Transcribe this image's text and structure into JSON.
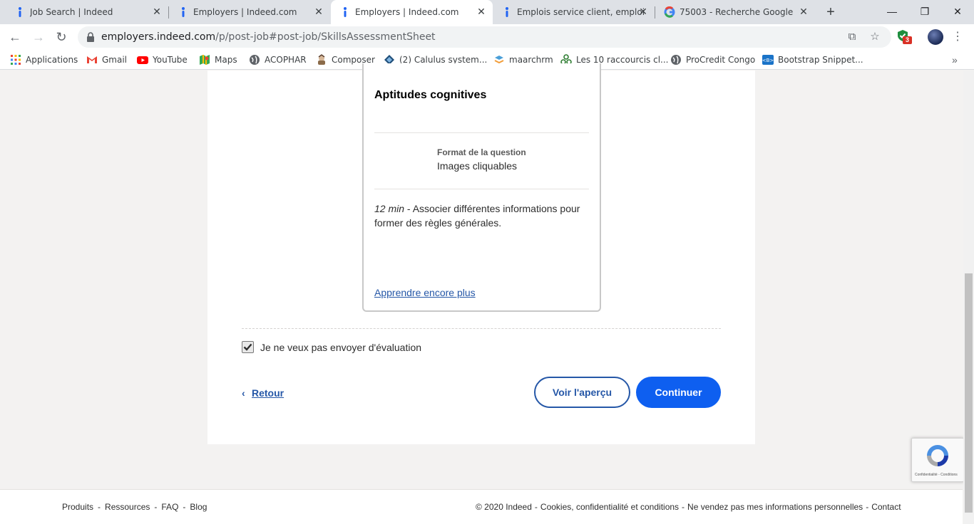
{
  "browser": {
    "tabs": [
      {
        "title": "Job Search | Indeed",
        "favicon": "indeed-icon"
      },
      {
        "title": "Employers | Indeed.com",
        "favicon": "indeed-icon"
      },
      {
        "title": "Employers | Indeed.com",
        "favicon": "indeed-icon",
        "active": true
      },
      {
        "title": "Emplois service client, emploi | ",
        "favicon": "indeed-icon"
      },
      {
        "title": "75003 - Recherche Google",
        "favicon": "google-icon"
      }
    ],
    "url_host": "employers.indeed.com",
    "url_path": "/p/post-job#post-job/SkillsAssessmentSheet",
    "extension_badge": "3",
    "bookmarks": [
      {
        "label": "Applications",
        "icon": "apps-grid-icon"
      },
      {
        "label": "Gmail",
        "icon": "gmail-icon"
      },
      {
        "label": "YouTube",
        "icon": "youtube-icon"
      },
      {
        "label": "Maps",
        "icon": "maps-icon"
      },
      {
        "label": "ACOPHAR",
        "icon": "globe-icon"
      },
      {
        "label": "Composer",
        "icon": "composer-icon"
      },
      {
        "label": "(2) Calulus system...",
        "icon": "calulus-icon"
      },
      {
        "label": "maarchrm",
        "icon": "maarch-icon"
      },
      {
        "label": "Les 10 raccourcis cl...",
        "icon": "raccourcis-icon"
      },
      {
        "label": "ProCredit Congo",
        "icon": "globe-icon"
      },
      {
        "label": "Bootstrap Snippet...",
        "icon": "bootstrap-icon"
      }
    ]
  },
  "card": {
    "title": "Aptitudes cognitives",
    "format_label": "Format de la question",
    "format_value": "Images cliquables",
    "duration": "12 min",
    "description": " - Associer différentes informations pour former des règles générales.",
    "learn_more": "Apprendre encore plus"
  },
  "opt_out": {
    "label": "Je ne veux pas envoyer d'évaluation",
    "checked": true
  },
  "actions": {
    "back": "Retour",
    "preview": "Voir l'aperçu",
    "continue": "Continuer"
  },
  "recaptcha": {
    "text": "Confidentialité - Conditions"
  },
  "footer": {
    "left_links": [
      "Produits",
      "Ressources",
      "FAQ",
      "Blog"
    ],
    "copyright": "© 2020 Indeed",
    "cookies": "Cookies, confidentialité et conditions",
    "do_not_sell": "Ne vendez pas mes informations personnelles",
    "contact": "Contact"
  },
  "colors": {
    "accent": "#2557a7",
    "primary_button": "#0e5ff0",
    "page_bg": "#f3f2f1"
  }
}
